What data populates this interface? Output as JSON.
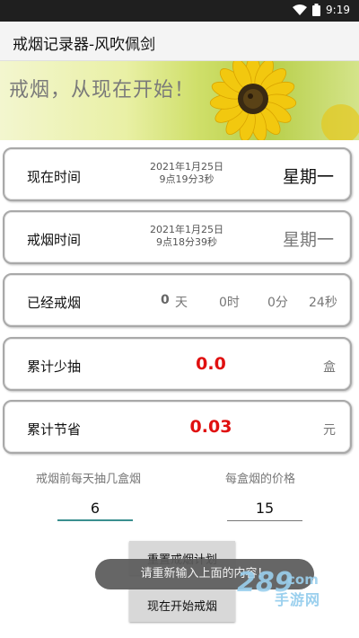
{
  "status_bar": {
    "time": "9:19"
  },
  "app_bar": {
    "title": "戒烟记录器-风吹佩剑"
  },
  "banner": {
    "slogan": "戒烟，从现在开始！"
  },
  "cards": {
    "now": {
      "label": "现在时间",
      "date": "2021年1月25日",
      "time": "9点19分3秒",
      "weekday": "星期一"
    },
    "quit": {
      "label": "戒烟时间",
      "date": "2021年1月25日",
      "time": "9点18分39秒",
      "weekday": "星期一"
    },
    "elapsed": {
      "label": "已经戒烟",
      "days_value": "0",
      "days_unit": "天",
      "hours": "0时",
      "minutes": "0分",
      "seconds": "24秒"
    },
    "reduced": {
      "label": "累计少抽",
      "value": "0.0",
      "unit": "盒"
    },
    "saved": {
      "label": "累计节省",
      "value": "0.03",
      "unit": "元"
    }
  },
  "form": {
    "daily_label": "戒烟前每天抽几盒烟",
    "daily_value": "6",
    "price_label": "每盒烟的价格",
    "price_value": "15"
  },
  "buttons": {
    "reset": "重置戒烟计划",
    "start": "现在开始戒烟"
  },
  "toast": {
    "message": "请重新输入上面的内容！"
  },
  "watermark": {
    "text": "手游网"
  },
  "colors": {
    "accent_red": "#e01010",
    "input_underline": "#3a8f8f"
  }
}
